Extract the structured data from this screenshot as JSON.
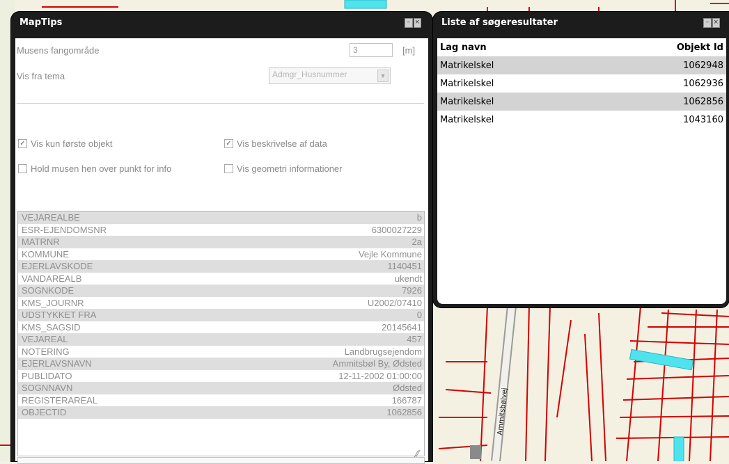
{
  "map": {
    "road_label": "Ammitsbølvej"
  },
  "maptips": {
    "title": "MapTips",
    "capture_label": "Musens fangområde",
    "capture_value": "3",
    "capture_unit": "[m]",
    "theme_label": "Vis fra tema",
    "theme_value": "Admgr_Husnummer",
    "checkboxes": [
      {
        "label": "Vis kun første objekt",
        "checked": true
      },
      {
        "label": "Vis beskrivelse af data",
        "checked": true
      },
      {
        "label": "Hold musen hen over punkt for info",
        "checked": false
      },
      {
        "label": "Vis geometri informationer",
        "checked": false
      }
    ],
    "attributes": [
      {
        "key": "VEJAREALBE",
        "value": "b"
      },
      {
        "key": "ESR-EJENDOMSNR",
        "value": "6300027229"
      },
      {
        "key": "MATRNR",
        "value": "2a"
      },
      {
        "key": "KOMMUNE",
        "value": "Vejle Kommune"
      },
      {
        "key": "EJERLAVSKODE",
        "value": "1140451"
      },
      {
        "key": "VANDAREALB",
        "value": "ukendt"
      },
      {
        "key": "SOGNKODE",
        "value": "7926"
      },
      {
        "key": "KMS_JOURNR",
        "value": "U2002/07410"
      },
      {
        "key": "UDSTYKKET FRA",
        "value": "0"
      },
      {
        "key": "KMS_SAGSID",
        "value": "20145641"
      },
      {
        "key": "VEJAREAL",
        "value": "457"
      },
      {
        "key": "NOTERING",
        "value": "Landbrugsejendom"
      },
      {
        "key": "EJERLAVSNAVN",
        "value": "Ammitsbøl By, Ødsted"
      },
      {
        "key": "PUBLIDATO",
        "value": "12-11-2002 01:00:00"
      },
      {
        "key": "SOGNNAVN",
        "value": "Ødsted"
      },
      {
        "key": "REGISTERAREAL",
        "value": "166787"
      },
      {
        "key": "OBJECTID",
        "value": "1062856"
      }
    ]
  },
  "results": {
    "title": "Liste af søgeresultater",
    "col_layer": "Lag navn",
    "col_id": "Objekt Id",
    "rows": [
      {
        "layer": "Matrikelskel",
        "id": "1062948"
      },
      {
        "layer": "Matrikelskel",
        "id": "1062936"
      },
      {
        "layer": "Matrikelskel",
        "id": "1062856"
      },
      {
        "layer": "Matrikelskel",
        "id": "1043160"
      }
    ]
  },
  "colors": {
    "parcel_line": "#d40000",
    "highlight": "#4fe3ee",
    "panel_frame": "#1c1c1c"
  }
}
